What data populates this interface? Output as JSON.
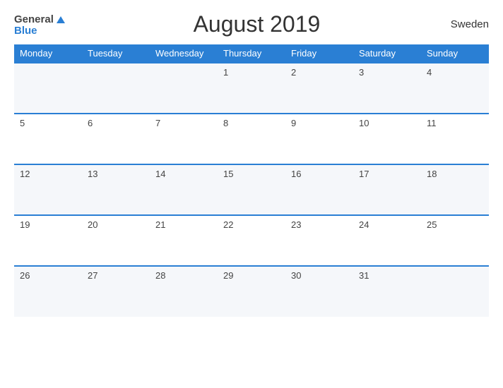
{
  "header": {
    "logo_general": "General",
    "logo_blue": "Blue",
    "title": "August 2019",
    "country": "Sweden"
  },
  "calendar": {
    "days_of_week": [
      "Monday",
      "Tuesday",
      "Wednesday",
      "Thursday",
      "Friday",
      "Saturday",
      "Sunday"
    ],
    "weeks": [
      [
        "",
        "",
        "",
        "1",
        "2",
        "3",
        "4"
      ],
      [
        "5",
        "6",
        "7",
        "8",
        "9",
        "10",
        "11"
      ],
      [
        "12",
        "13",
        "14",
        "15",
        "16",
        "17",
        "18"
      ],
      [
        "19",
        "20",
        "21",
        "22",
        "23",
        "24",
        "25"
      ],
      [
        "26",
        "27",
        "28",
        "29",
        "30",
        "31",
        ""
      ]
    ]
  }
}
